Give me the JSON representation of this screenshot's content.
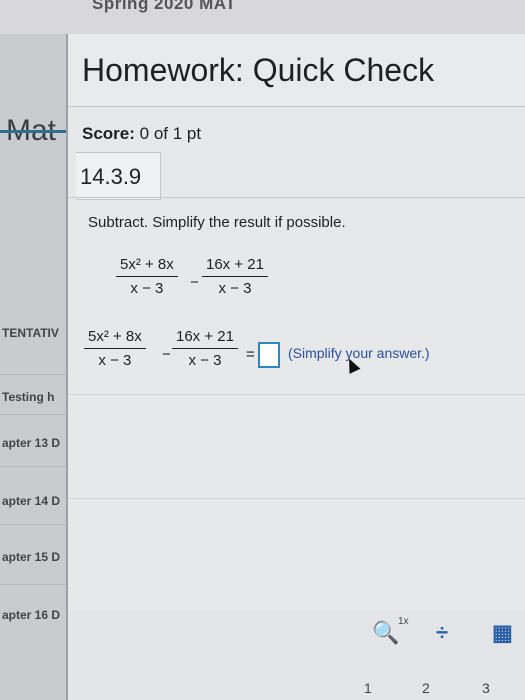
{
  "top_strip": {
    "text": "Spring 2020 MAT"
  },
  "left_panel": {
    "title": "Mat",
    "items": [
      "TENTATIV",
      "Testing h",
      "apter 13 D",
      "apter 14 D",
      "apter 15 D",
      "apter 16 D"
    ]
  },
  "dialog": {
    "title": "Homework: Quick Check",
    "score_label": "Score:",
    "score_value": "0 of 1 pt",
    "question_id": "14.3.9",
    "instructions": "Subtract. Simplify the result if possible."
  },
  "problem": {
    "frac1_num": "5x² + 8x",
    "frac1_den": "x − 3",
    "minus": "−",
    "frac2_num": "16x + 21",
    "frac2_den": "x − 3"
  },
  "answer_row": {
    "frac1_num": "5x² + 8x",
    "frac1_den": "x − 3",
    "minus": "−",
    "frac2_num": "16x + 21",
    "frac2_den": "x − 3",
    "equals": "=",
    "hint": "(Simplify your answer.)"
  },
  "toolbar": {
    "zoom_label": "1x"
  },
  "pagination": [
    "1",
    "2",
    "3"
  ],
  "colors": {
    "accent": "#2e86c1",
    "hint": "#2a4fa0",
    "tool": "#2a5fa8"
  }
}
